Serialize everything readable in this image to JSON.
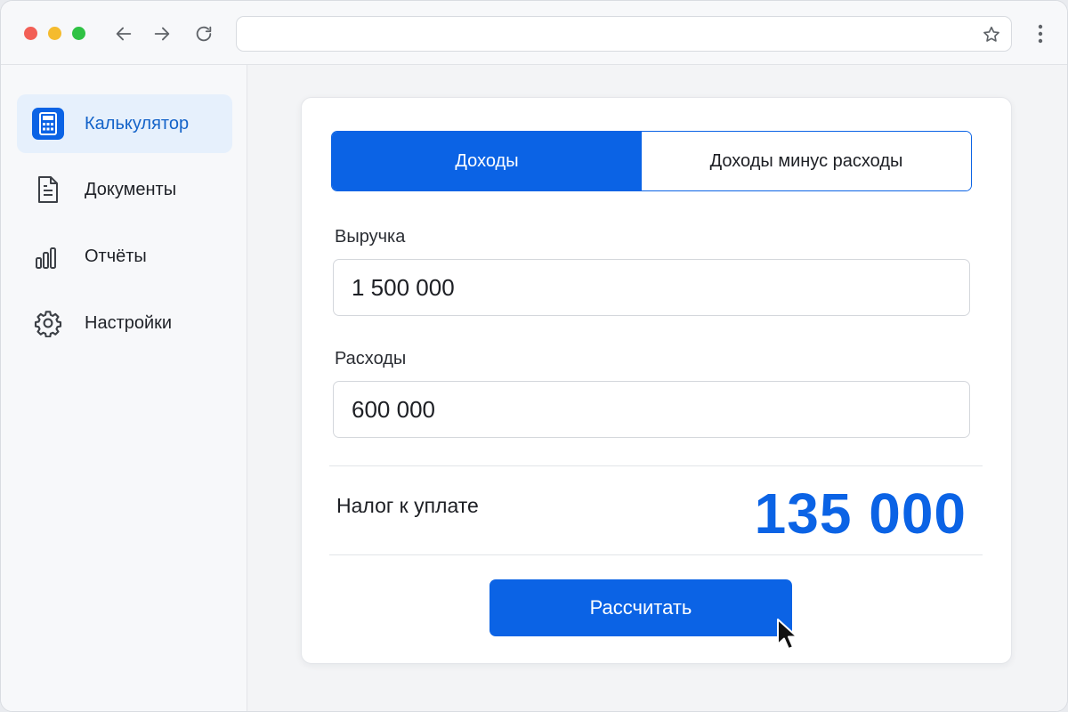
{
  "browser": {
    "address_value": "",
    "icons": [
      "back-arrow-icon",
      "forward-arrow-icon",
      "reload-icon",
      "star-icon",
      "more-vertical-icon"
    ]
  },
  "sidebar": {
    "items": [
      {
        "label": "Калькулятор",
        "icon": "calculator-icon",
        "active": true
      },
      {
        "label": "Документы",
        "icon": "document-icon",
        "active": false
      },
      {
        "label": "Отчёты",
        "icon": "bar-chart-icon",
        "active": false
      },
      {
        "label": "Настройки",
        "icon": "gear-icon",
        "active": false
      }
    ]
  },
  "calculator": {
    "tabs": [
      {
        "label": "Доходы",
        "active": true
      },
      {
        "label": "Доходы минус расходы",
        "active": false
      }
    ],
    "revenue": {
      "label": "Выручка",
      "value": "1 500 000"
    },
    "expenses": {
      "label": "Расходы",
      "value": "600 000"
    },
    "result": {
      "label": "Налог к уплате",
      "value": "135 000"
    },
    "button_label": "Рассчитать"
  },
  "colors": {
    "accent": "#0b63e5",
    "active_sidebar_bg": "#e6f0fc",
    "active_sidebar_text": "#1463c9"
  }
}
